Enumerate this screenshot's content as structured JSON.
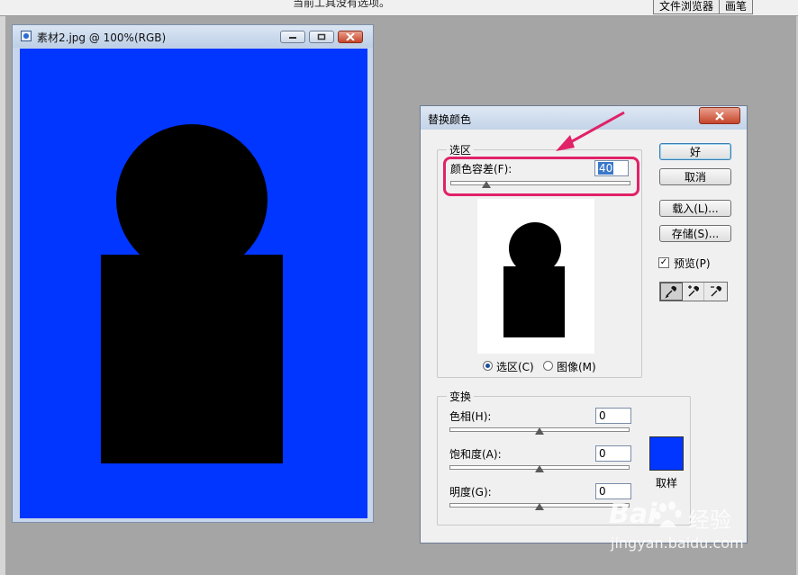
{
  "topbar": {
    "hint": "当前工具没有选项。",
    "tabs": [
      "文件浏览器",
      "画笔"
    ]
  },
  "document": {
    "title": "素材2.jpg @ 100%(RGB)",
    "canvas_color": "#0036ff",
    "shape_color": "#000000"
  },
  "dialog": {
    "title": "替换颜色",
    "selection": {
      "legend": "选区",
      "fuzziness_label": "颜色容差(F):",
      "fuzziness_value": "40",
      "fuzziness_slider": 0.2,
      "radio_selection": "选区(C)",
      "radio_image": "图像(M)"
    },
    "buttons": {
      "ok": "好",
      "cancel": "取消",
      "load": "载入(L)...",
      "save": "存储(S)..."
    },
    "preview_label": "预览(P)",
    "preview_checked": true,
    "transform": {
      "legend": "变换",
      "hue_label": "色相(H):",
      "hue_value": "0",
      "saturation_label": "饱和度(A):",
      "saturation_value": "0",
      "lightness_label": "明度(G):",
      "lightness_value": "0",
      "sample_label": "取样",
      "sample_color": "#0036ff"
    }
  },
  "annotation": {
    "highlight_color": "#e02268"
  },
  "watermark": {
    "brand": "Bai",
    "brand_tail": "经验",
    "url": "jingyan.baidu.com"
  }
}
